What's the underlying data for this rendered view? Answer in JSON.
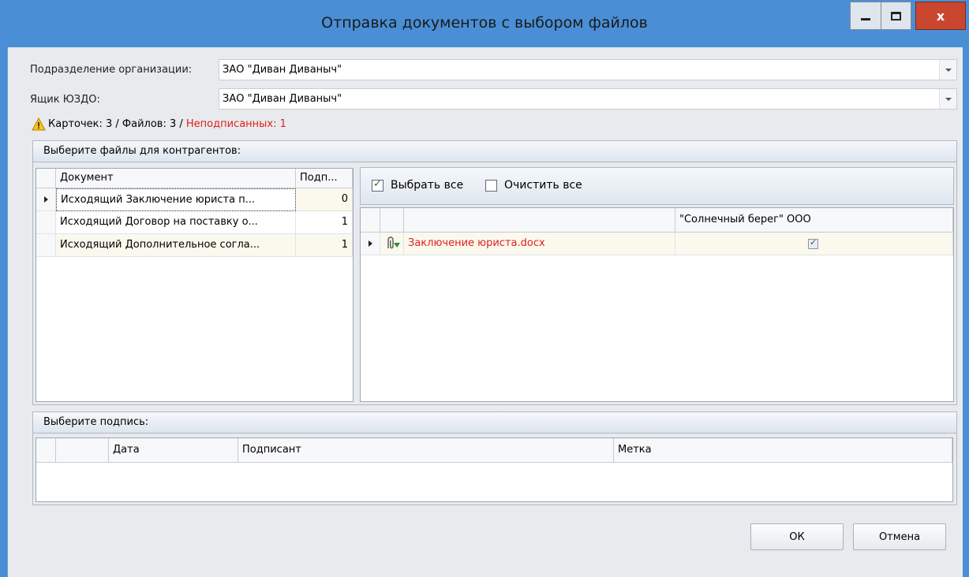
{
  "window": {
    "title": "Отправка документов с выбором файлов",
    "close_glyph": "x"
  },
  "form": {
    "org_label": "Подразделение организации:",
    "org_value": "ЗАО \"Диван Диваныч\"",
    "box_label": "Ящик ЮЗДО:",
    "box_value": "ЗАО \"Диван Диваныч\""
  },
  "status": {
    "counts": "Карточек: 3 / Файлов: 3 / ",
    "unsigned": "Неподписанных: 1"
  },
  "files_group": {
    "title": "Выберите файлы для контрагентов:",
    "doc_grid": {
      "columns": [
        "Документ",
        "Подп..."
      ],
      "rows": [
        {
          "document": "Исходящий Заключение юриста п...",
          "signed": "0"
        },
        {
          "document": "Исходящий Договор на поставку о...",
          "signed": "1"
        },
        {
          "document": "Исходящий Дополнительное согла...",
          "signed": "1"
        }
      ]
    },
    "toolbar": {
      "select_all": "Выбрать все",
      "clear_all": "Очистить все"
    },
    "file_grid": {
      "columns": [
        "",
        "",
        "\"Солнечный берег\" ООО"
      ],
      "rows": [
        {
          "file": "Заключение юриста.docx",
          "checked": true
        }
      ]
    }
  },
  "sign_group": {
    "title": "Выберите подпись:",
    "columns": [
      "Дата",
      "Подписант",
      "Метка"
    ]
  },
  "buttons": {
    "ok": "ОК",
    "cancel": "Отмена"
  },
  "colors": {
    "title_bar": "#4a8fd6",
    "close_button": "#c9472f",
    "warning_red": "#e01f1f",
    "selected_row": "#fbf8ed"
  },
  "icons": [
    "minimize-icon",
    "maximize-icon",
    "close-icon",
    "warning-icon",
    "chevron-down-icon",
    "row-pointer-icon",
    "paperclip-icon",
    "checkbox-icon"
  ]
}
